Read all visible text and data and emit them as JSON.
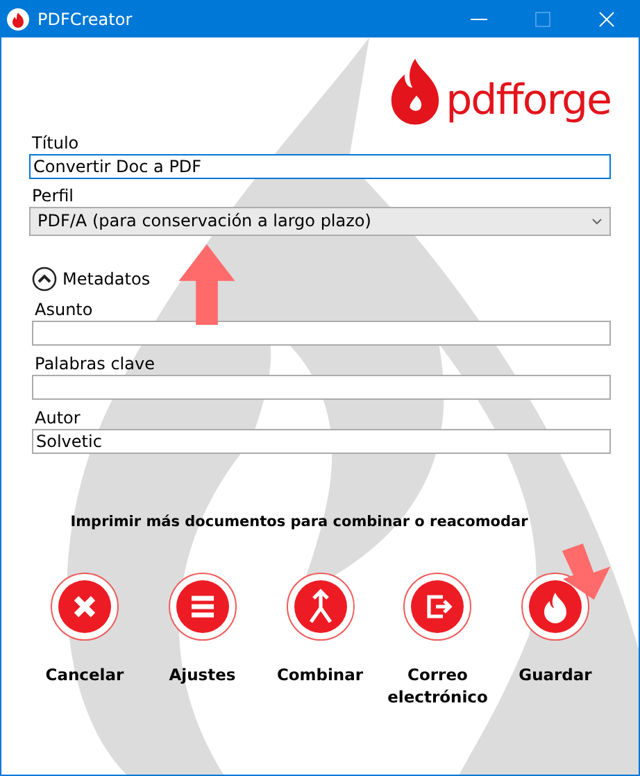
{
  "window": {
    "title": "PDFCreator"
  },
  "logo_text": "pdfforge",
  "fields": [
    {
      "kind": "text",
      "label": "Título",
      "value": "Convertir Doc a PDF",
      "focused": true
    },
    {
      "kind": "select",
      "label": "Perfil",
      "value": "PDF/A (para conservación a largo plazo)",
      "focused": false
    }
  ],
  "metadata": {
    "label": "Metadatos",
    "expanded": true,
    "fields": [
      {
        "label": "Asunto"
      },
      {
        "label": "Palabras clave"
      },
      {
        "label": "Autor",
        "value": "Solvetic"
      }
    ]
  },
  "hint": "Imprimir más documentos para combinar o reacomodar",
  "actions": [
    {
      "kind": "cancel",
      "label": "Cancelar"
    },
    {
      "kind": "settings",
      "label": "Ajustes"
    },
    {
      "kind": "merge",
      "label": "Combinar"
    },
    {
      "kind": "email",
      "label": "Correo electrónico"
    },
    {
      "kind": "save",
      "label": "Guardar"
    }
  ]
}
